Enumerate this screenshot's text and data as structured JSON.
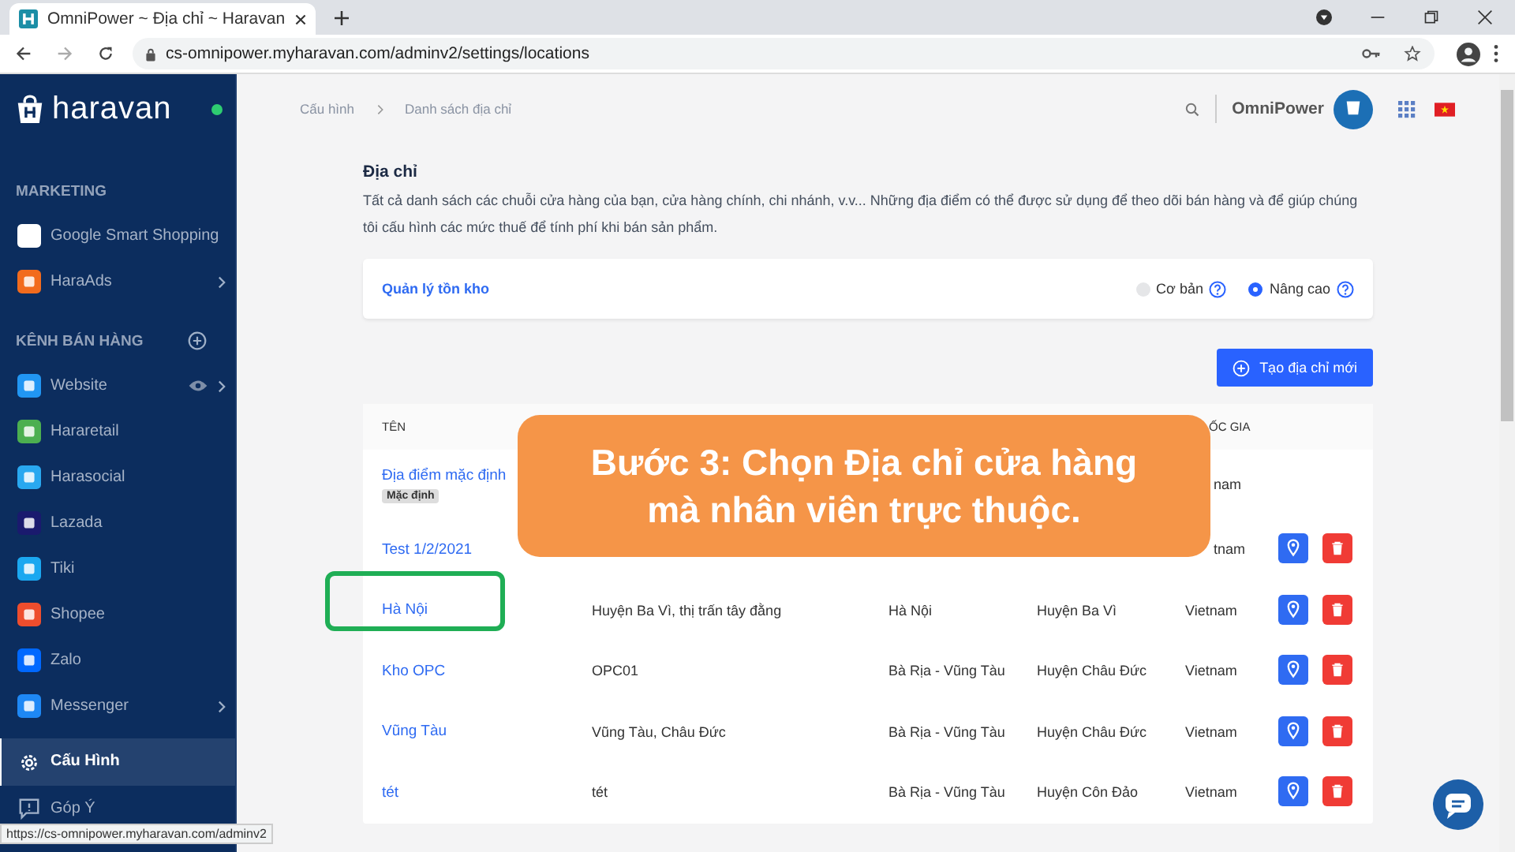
{
  "browser": {
    "tab_title": "OmniPower ~ Địa chỉ ~ Haravan",
    "url": "cs-omnipower.myharavan.com/adminv2/settings/locations",
    "status_url": "https://cs-omnipower.myharavan.com/adminv2"
  },
  "sidebar": {
    "logo": "haravan",
    "online": true,
    "sections": [
      {
        "heading": "MARKETING",
        "add_button": false,
        "items": [
          {
            "label": "Google Smart Shopping",
            "color": "#ffffff",
            "expandable": false,
            "previewable": false,
            "selected": false
          },
          {
            "label": "HaraAds",
            "color": "#f26b1d",
            "expandable": true,
            "previewable": false,
            "selected": false
          }
        ]
      },
      {
        "heading": "KÊNH BÁN HÀNG",
        "add_button": true,
        "items": [
          {
            "label": "Website",
            "color": "#2196f3",
            "expandable": true,
            "previewable": true,
            "selected": false
          },
          {
            "label": "Hararetail",
            "color": "#4caf50",
            "expandable": false,
            "previewable": false,
            "selected": false
          },
          {
            "label": "Harasocial",
            "color": "#29a8f0",
            "expandable": false,
            "previewable": false,
            "selected": false
          },
          {
            "label": "Lazada",
            "color": "#1a1a6e",
            "expandable": false,
            "previewable": false,
            "selected": false
          },
          {
            "label": "Tiki",
            "color": "#1ba8f0",
            "expandable": false,
            "previewable": false,
            "selected": false
          },
          {
            "label": "Shopee",
            "color": "#ee4d2d",
            "expandable": false,
            "previewable": false,
            "selected": false
          },
          {
            "label": "Zalo",
            "color": "#0068ff",
            "expandable": false,
            "previewable": false,
            "selected": false
          },
          {
            "label": "Messenger",
            "color": "#1e88f5",
            "expandable": true,
            "previewable": false,
            "selected": false
          }
        ]
      },
      {
        "items": [
          {
            "label": "Cấu Hình",
            "kind": "settings",
            "expandable": false,
            "previewable": false,
            "selected": true
          },
          {
            "label": "Góp Ý",
            "kind": "feedback",
            "expandable": false,
            "previewable": false,
            "selected": false
          }
        ]
      }
    ]
  },
  "header": {
    "breadcrumbs": [
      "Cấu hình",
      "Danh sách địa chỉ"
    ],
    "shop_name": "OmniPower"
  },
  "page": {
    "title": "Địa chỉ",
    "description": "Tất cả danh sách các chuỗi cửa hàng của bạn, cửa hàng chính, chi nhánh, v.v... Những địa điểm có thể được sử dụng để theo dõi bán hàng và để giúp chúng tôi cấu hình các mức thuế để tính phí khi bán sản phẩm.",
    "inventory": {
      "label": "Quản lý tồn kho",
      "options": [
        {
          "label": "Cơ bản",
          "selected": false
        },
        {
          "label": "Nâng cao",
          "selected": true
        }
      ]
    },
    "create_button": "Tạo địa chỉ mới"
  },
  "table": {
    "columns": [
      "TÊN",
      "",
      "",
      "",
      "ỐC GIA"
    ],
    "rows": [
      {
        "name": "Địa điểm mặc định",
        "badge": "Mặc định",
        "address": "",
        "province": "",
        "district": "",
        "country": "nam",
        "country_clipped": true,
        "actions": false,
        "highlighted": false
      },
      {
        "name": "Test 1/2/2021",
        "address": "",
        "province": "",
        "district": "",
        "country": "tnam",
        "country_clipped": true,
        "actions": true,
        "highlighted": false
      },
      {
        "name": "Hà Nội",
        "address": "Huyện Ba Vì, thị trấn tây đằng",
        "province": "Hà Nội",
        "district": "Huyện Ba Vì",
        "country": "Vietnam",
        "country_clipped": false,
        "actions": true,
        "highlighted": true
      },
      {
        "name": "Kho OPC",
        "address": "OPC01",
        "province": "Bà Rịa - Vũng Tàu",
        "district": "Huyện Châu Đức",
        "country": "Vietnam",
        "country_clipped": false,
        "actions": true,
        "highlighted": false
      },
      {
        "name": "Vũng Tàu",
        "address": "Vũng Tàu, Châu Đức",
        "province": "Bà Rịa - Vũng Tàu",
        "district": "Huyện Châu Đức",
        "country": "Vietnam",
        "country_clipped": false,
        "actions": true,
        "highlighted": false
      },
      {
        "name": "tét",
        "address": "tét",
        "province": "Bà Rịa - Vũng Tàu",
        "district": "Huyện Côn Đảo",
        "country": "Vietnam",
        "country_clipped": false,
        "actions": true,
        "highlighted": false
      }
    ]
  },
  "callout": "Bước 3: Chọn Địa chỉ cửa hàng mà nhân viên trực thuộc."
}
